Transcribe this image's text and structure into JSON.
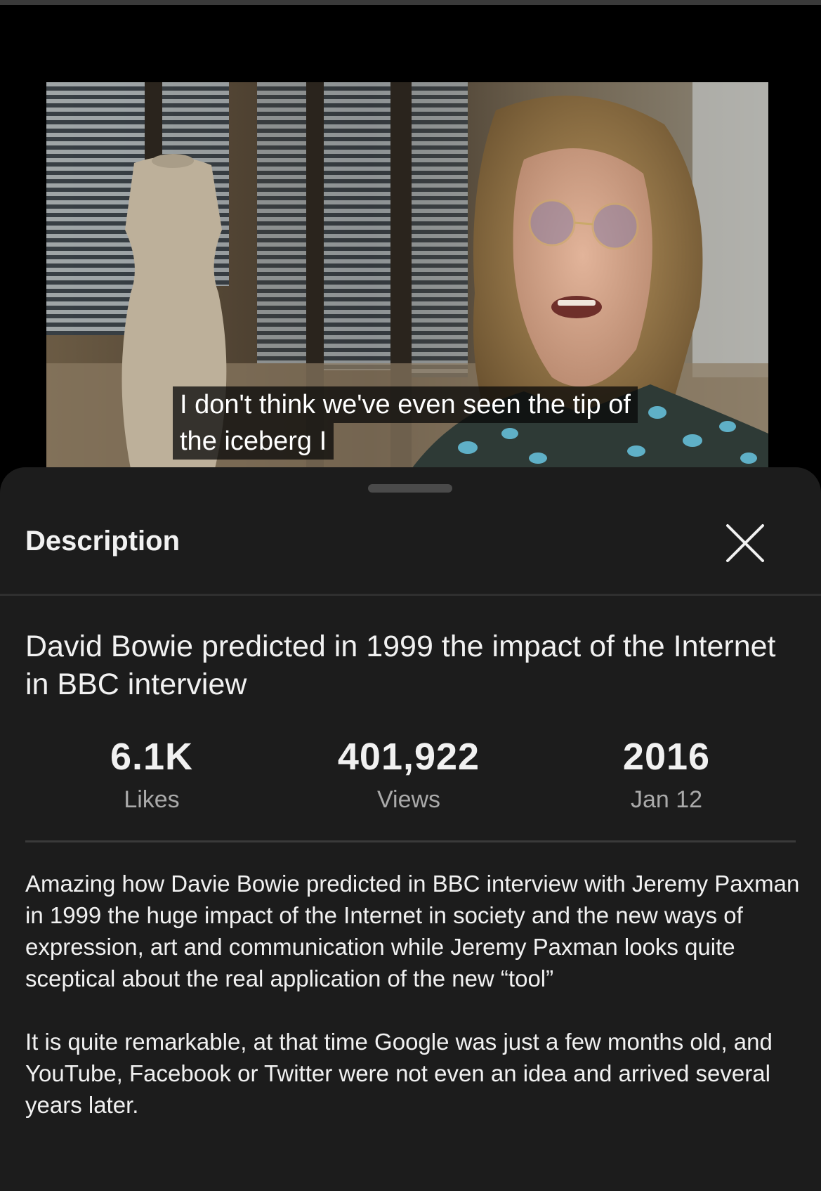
{
  "video": {
    "caption_lines": [
      "I don't think we've even seen the tip of",
      "the iceberg I"
    ]
  },
  "sheet": {
    "title": "Description",
    "close_icon": "close-icon"
  },
  "details": {
    "video_title": "David Bowie predicted in 1999 the impact of the Internet in BBC interview",
    "stats": {
      "likes": {
        "value": "6.1K",
        "label": "Likes"
      },
      "views": {
        "value": "401,922",
        "label": "Views"
      },
      "date": {
        "value": "2016",
        "label": "Jan 12"
      }
    },
    "description_paragraphs": [
      "Amazing how Davie Bowie predicted in BBC interview with Jeremy Paxman in 1999 the huge impact of the Internet in society and the new ways of expression, art and communication while Jeremy Paxman looks quite sceptical about the real application of the new “tool”",
      "It is quite remarkable, at that time Google was just a few months old, and YouTube, Facebook or Twitter were not even an idea and arrived several years later."
    ]
  },
  "colors": {
    "sheet_background": "#1c1c1c",
    "text_primary": "#f1f1f1",
    "text_secondary": "#aaaaaa",
    "divider": "#3a3a3a"
  }
}
